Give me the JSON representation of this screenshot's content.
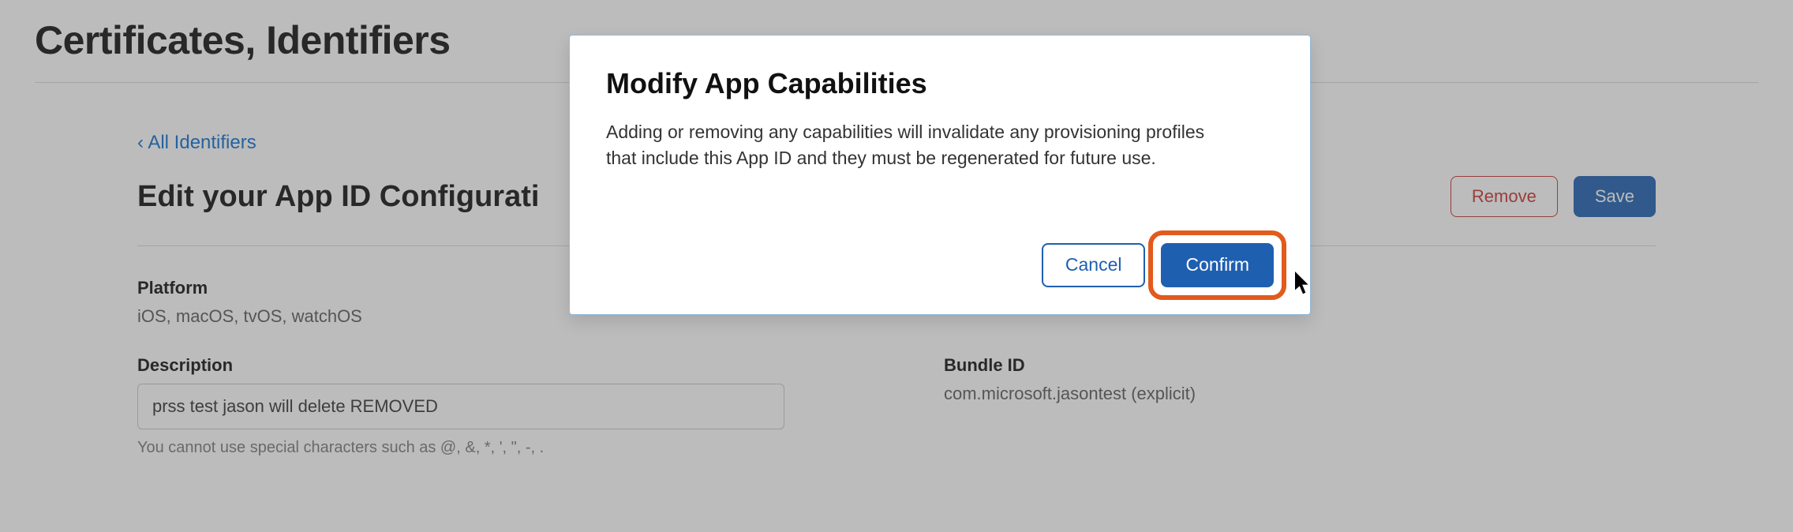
{
  "page": {
    "title": "Certificates, Identifiers",
    "back_link": "‹ All Identifiers",
    "sub_title": "Edit your App ID Configurati",
    "remove_label": "Remove",
    "save_label": "Save"
  },
  "fields": {
    "platform_label": "Platform",
    "platform_value": "iOS, macOS, tvOS, watchOS",
    "description_label": "Description",
    "description_value": "prss test jason will delete REMOVED",
    "description_hint": "You cannot use special characters such as @, &, *, ', \", -, .",
    "bundle_label": "Bundle ID",
    "bundle_value": "com.microsoft.jasontest (explicit)"
  },
  "modal": {
    "title": "Modify App Capabilities",
    "body": "Adding or removing any capabilities will invalidate any provisioning profiles that include this App ID and they must be regenerated for future use.",
    "cancel_label": "Cancel",
    "confirm_label": "Confirm"
  }
}
